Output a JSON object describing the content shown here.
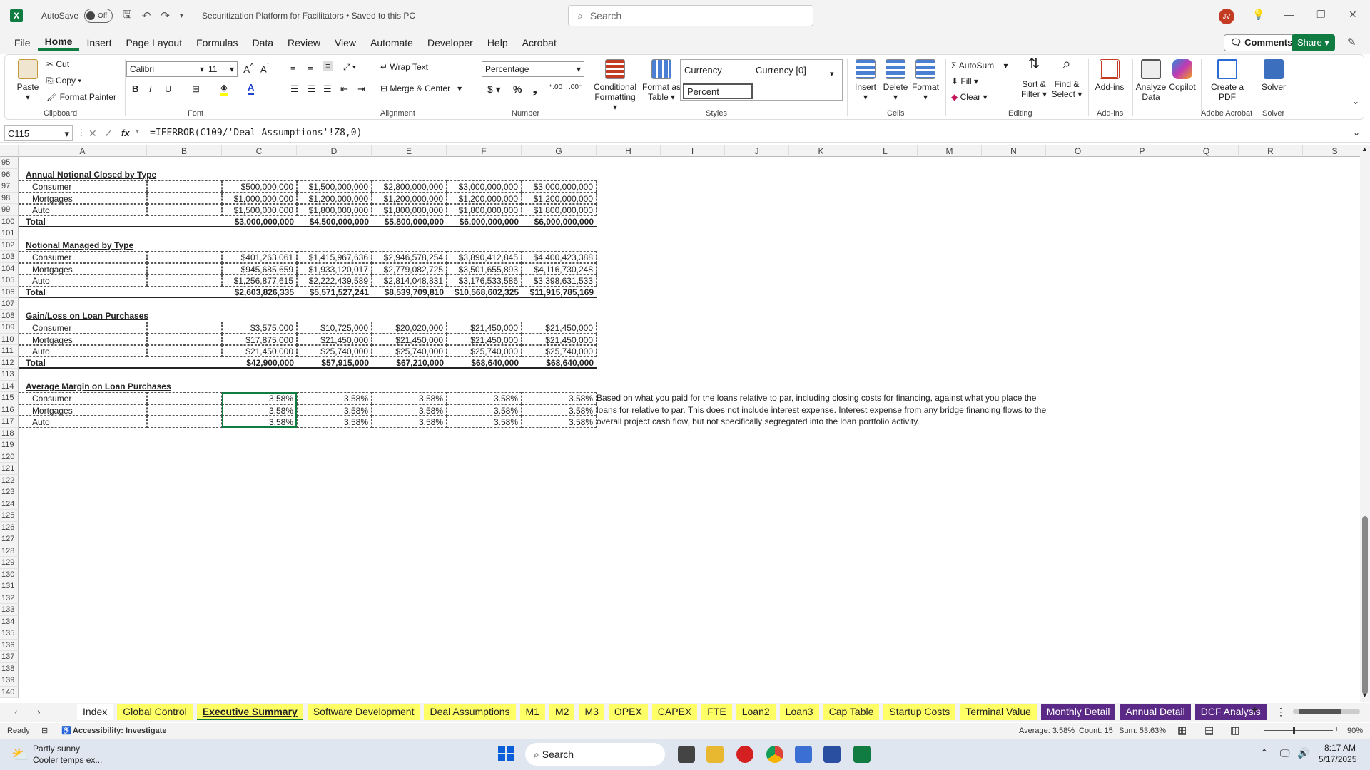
{
  "titlebar": {
    "logo": "X",
    "autosave_label": "AutoSave",
    "autosave_state": "Off",
    "doc_title": "Securitization Platform for Facilitators • Saved to this PC",
    "search_placeholder": "Search",
    "avatar_initials": "JV"
  },
  "menu": [
    "File",
    "Home",
    "Insert",
    "Page Layout",
    "Formulas",
    "Data",
    "Review",
    "View",
    "Automate",
    "Developer",
    "Help",
    "Acrobat"
  ],
  "menu_active": "Home",
  "comments_label": "Comments",
  "share_label": "Share",
  "ribbon": {
    "clipboard": {
      "paste": "Paste",
      "cut": "Cut",
      "copy": "Copy",
      "format_painter": "Format Painter",
      "label": "Clipboard"
    },
    "font": {
      "name": "Calibri",
      "size": "11",
      "label": "Font"
    },
    "alignment": {
      "wrap": "Wrap Text",
      "merge": "Merge & Center",
      "label": "Alignment"
    },
    "number": {
      "format": "Percentage",
      "label": "Number"
    },
    "styles": {
      "cond": "Conditional Formatting",
      "fmt_table": "Format as Table",
      "currency": "Currency",
      "currency0": "Currency [0]",
      "percent": "Percent",
      "label": "Styles"
    },
    "cells": {
      "insert": "Insert",
      "delete": "Delete",
      "format": "Format",
      "label": "Cells"
    },
    "editing": {
      "autosum": "AutoSum",
      "fill": "Fill",
      "clear": "Clear",
      "sort": "Sort & Filter",
      "find": "Find & Select",
      "label": "Editing"
    },
    "addins": {
      "addins": "Add-ins",
      "analyze": "Analyze Data",
      "copilot": "Copilot",
      "label": "Add-ins"
    },
    "acrobat": {
      "create": "Create a PDF",
      "label": "Adobe Acrobat"
    },
    "solver": {
      "solver": "Solver",
      "label": "Solver"
    }
  },
  "formula": {
    "namebox": "C115",
    "fx": "fx",
    "content": "=IFERROR(C109/'Deal Assumptions'!Z8,0)"
  },
  "columns": [
    "A",
    "B",
    "C",
    "D",
    "E",
    "F",
    "G",
    "H",
    "I",
    "J",
    "K",
    "L",
    "M",
    "N",
    "O",
    "P",
    "Q",
    "R",
    "S"
  ],
  "rows_start": 95,
  "rows_end": 140,
  "sections": {
    "s1_title": "Annual Notional Closed by Type",
    "s1": [
      {
        "label": "Consumer",
        "vals": [
          "$500,000,000",
          "$1,500,000,000",
          "$2,800,000,000",
          "$3,000,000,000",
          "$3,000,000,000"
        ]
      },
      {
        "label": "Mortgages",
        "vals": [
          "$1,000,000,000",
          "$1,200,000,000",
          "$1,200,000,000",
          "$1,200,000,000",
          "$1,200,000,000"
        ]
      },
      {
        "label": "Auto",
        "vals": [
          "$1,500,000,000",
          "$1,800,000,000",
          "$1,800,000,000",
          "$1,800,000,000",
          "$1,800,000,000"
        ]
      },
      {
        "label": "Total",
        "vals": [
          "$3,000,000,000",
          "$4,500,000,000",
          "$5,800,000,000",
          "$6,000,000,000",
          "$6,000,000,000"
        ]
      }
    ],
    "s2_title": "Notional Managed by Type",
    "s2": [
      {
        "label": "Consumer",
        "vals": [
          "$401,263,061",
          "$1,415,967,636",
          "$2,946,578,254",
          "$3,890,412,845",
          "$4,400,423,388"
        ]
      },
      {
        "label": "Mortgages",
        "vals": [
          "$945,685,659",
          "$1,933,120,017",
          "$2,779,082,725",
          "$3,501,655,893",
          "$4,116,730,248"
        ]
      },
      {
        "label": "Auto",
        "vals": [
          "$1,256,877,615",
          "$2,222,439,589",
          "$2,814,048,831",
          "$3,176,533,586",
          "$3,398,631,533"
        ]
      },
      {
        "label": "Total",
        "vals": [
          "$2,603,826,335",
          "$5,571,527,241",
          "$8,539,709,810",
          "$10,568,602,325",
          "$11,915,785,169"
        ]
      }
    ],
    "s3_title": "Gain/Loss on Loan Purchases",
    "s3": [
      {
        "label": "Consumer",
        "vals": [
          "$3,575,000",
          "$10,725,000",
          "$20,020,000",
          "$21,450,000",
          "$21,450,000"
        ]
      },
      {
        "label": "Mortgages",
        "vals": [
          "$17,875,000",
          "$21,450,000",
          "$21,450,000",
          "$21,450,000",
          "$21,450,000"
        ]
      },
      {
        "label": "Auto",
        "vals": [
          "$21,450,000",
          "$25,740,000",
          "$25,740,000",
          "$25,740,000",
          "$25,740,000"
        ]
      },
      {
        "label": "Total",
        "vals": [
          "$42,900,000",
          "$57,915,000",
          "$67,210,000",
          "$68,640,000",
          "$68,640,000"
        ]
      }
    ],
    "s4_title": "Average Margin on Loan Purchases",
    "s4": [
      {
        "label": "Consumer",
        "vals": [
          "3.58%",
          "3.58%",
          "3.58%",
          "3.58%",
          "3.58%"
        ]
      },
      {
        "label": "Mortgages",
        "vals": [
          "3.58%",
          "3.58%",
          "3.58%",
          "3.58%",
          "3.58%"
        ]
      },
      {
        "label": "Auto",
        "vals": [
          "3.58%",
          "3.58%",
          "3.58%",
          "3.58%",
          "3.58%"
        ]
      }
    ],
    "note": [
      "Based on what you paid for the loans relative to par, including closing costs for financing, against what you place the",
      "loans for relative to par. This does not include interest expense. Interest expense from any bridge financing flows to the",
      "overall project cash flow, but not specifically segregated into the loan portfolio activity."
    ]
  },
  "tabs": [
    {
      "name": "Index",
      "color": "#ffffff"
    },
    {
      "name": "Global Control",
      "color": "#ffff66"
    },
    {
      "name": "Executive Summary",
      "color": "#ffff66",
      "active": true
    },
    {
      "name": "Software Development",
      "color": "#ffff66"
    },
    {
      "name": "Deal Assumptions",
      "color": "#ffff66"
    },
    {
      "name": "M1",
      "color": "#ffff66"
    },
    {
      "name": "M2",
      "color": "#ffff66"
    },
    {
      "name": "M3",
      "color": "#ffff66"
    },
    {
      "name": "OPEX",
      "color": "#ffff66"
    },
    {
      "name": "CAPEX",
      "color": "#ffff66"
    },
    {
      "name": "FTE",
      "color": "#ffff66"
    },
    {
      "name": "Loan2",
      "color": "#ffff66"
    },
    {
      "name": "Loan3",
      "color": "#ffff66"
    },
    {
      "name": "Cap Table",
      "color": "#ffff66"
    },
    {
      "name": "Startup Costs",
      "color": "#ffff66"
    },
    {
      "name": "Terminal Value",
      "color": "#ffff66"
    },
    {
      "name": "Monthly Detail",
      "color": "#5b2a86"
    },
    {
      "name": "Annual Detail",
      "color": "#5b2a86"
    },
    {
      "name": "DCF Analysis",
      "color": "#5b2a86"
    }
  ],
  "status": {
    "ready": "Ready",
    "accessibility": "Accessibility: Investigate",
    "average": "Average: 3.58%",
    "count": "Count: 15",
    "sum": "Sum: 53.63%",
    "zoom": "90%"
  },
  "taskbar": {
    "weather_title": "Partly sunny",
    "weather_sub": "Cooler temps ex...",
    "search": "Search",
    "time": "8:17 AM",
    "date": "5/17/2025"
  }
}
